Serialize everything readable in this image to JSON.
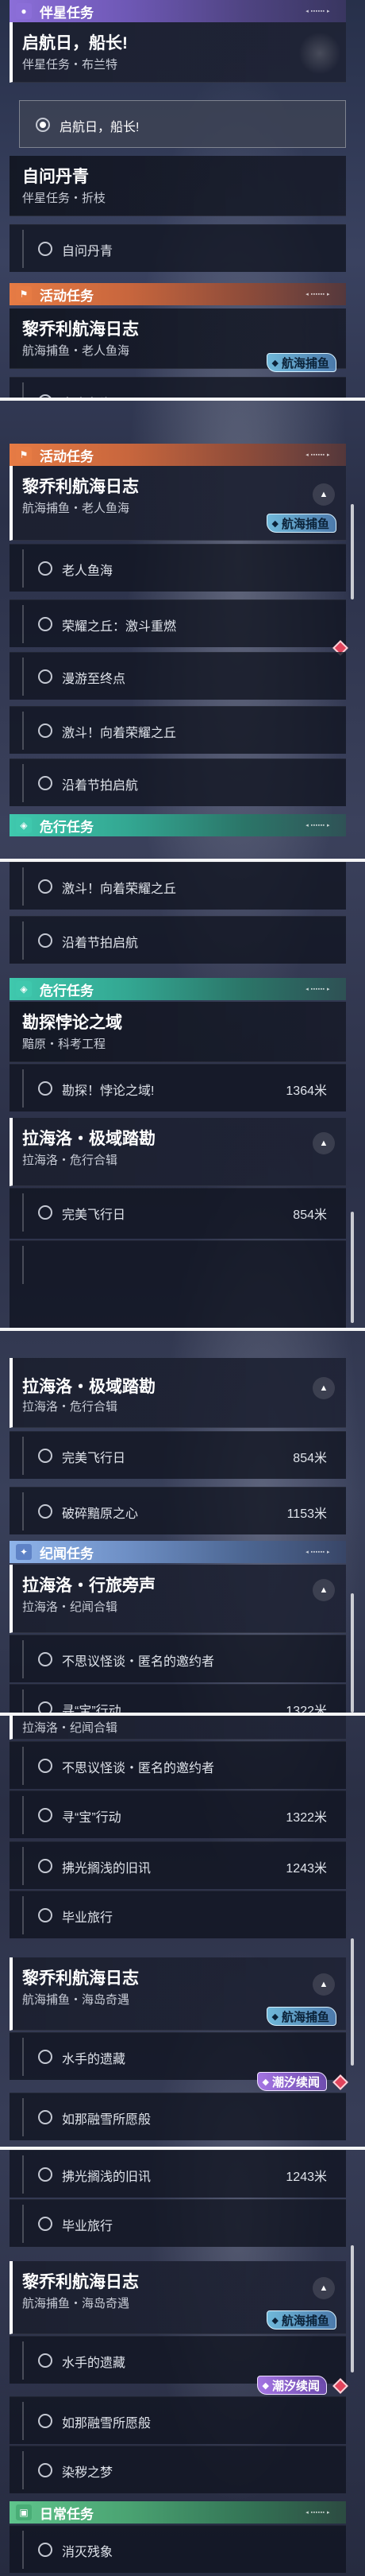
{
  "sections": {
    "companion": "伴星任务",
    "event": "活动任务",
    "danger": "危行任务",
    "exploration": "危行任务",
    "chronicle": "纪闻任务",
    "daily": "日常任务"
  },
  "header_meta": "◂ ▪▪▪▪▪▪ ▸",
  "quests": {
    "q1": {
      "title": "启航日，船长!",
      "sub": "伴星任务・布兰特"
    },
    "q2": {
      "title": "自问丹青",
      "sub": "伴星任务・折枝"
    },
    "q3": {
      "title": "黎乔利航海日志",
      "sub": "航海捕鱼・老人鱼海"
    },
    "q4": {
      "title": "勘探悖论之域",
      "sub": "黯原・科考工程"
    },
    "q5": {
      "title": "拉海洛・极域踏勘",
      "sub": "拉海洛・危行合辑"
    },
    "q6": {
      "title": "拉海洛・行旅旁声",
      "sub": "拉海洛・纪闻合辑"
    },
    "q7": {
      "title": "黎乔利航海日志",
      "sub": "航海捕鱼・海岛奇遇"
    }
  },
  "subtasks": {
    "s_launch": "启航日，船长!",
    "s_painting": "自问丹青",
    "s_oldfish": "老人鱼海",
    "s_rongyao": "荣耀之丘：激斗重燃",
    "s_manyou": "漫游至终点",
    "s_jili": "激斗！向着荣耀之丘",
    "s_yanzhe": "沿着节拍启航",
    "s_kantan": "勘探！悖论之域!",
    "s_wanmei": "完美飞行日",
    "s_posui": "破碎黯原之心",
    "s_busiyi": "不思议怪谈・匿名的邀约者",
    "s_xunbao": "寻“宝”行动",
    "s_fuguang": "拂光搁浅的旧讯",
    "s_biye": "毕业旅行",
    "s_shuishou": "水手的遗藏",
    "s_runa": "如那融雪所愿般",
    "s_ranyi": "染秽之梦",
    "s_xiaomie": "消灭残象"
  },
  "distances": {
    "kantan": "1364米",
    "wanmei": "854米",
    "posui": "1153米",
    "xunbao": "1322米",
    "fuguang": "1243米"
  },
  "badges": {
    "fishing": "航海捕鱼",
    "tide": "潮汐续闻"
  },
  "partial_text": {
    "chronicle_sub": "拉海洛・纪闻合辑"
  },
  "colors": {
    "companion": "#8b6ed8",
    "event": "#e67b44",
    "danger": "#3fc8ad",
    "chronicle": "#8fb4ea",
    "daily": "#5fc48c",
    "fishing_badge": "#78c8eb",
    "tide_badge": "#aa78eb",
    "warning": "#e2445c"
  },
  "icons": {
    "companion": "person-icon",
    "event": "flag-icon",
    "danger": "danger-icon",
    "chronicle": "star-icon",
    "daily": "calendar-icon"
  }
}
